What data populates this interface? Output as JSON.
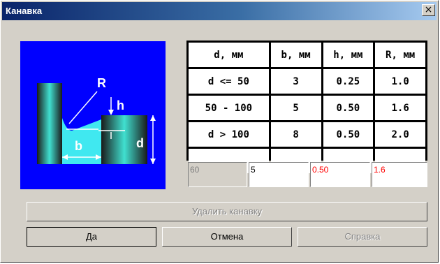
{
  "window": {
    "title": "Канавка",
    "close_label": "×"
  },
  "diagram": {
    "label_R": "R",
    "label_h": "h",
    "label_b": "b",
    "label_d": "d"
  },
  "table": {
    "headers": [
      "d, мм",
      "b, мм",
      "h, мм",
      "R, мм"
    ],
    "rows": [
      [
        "d <= 50",
        "3",
        "0.25",
        "1.0"
      ],
      [
        "50 - 100",
        "5",
        "0.50",
        "1.6"
      ],
      [
        "d > 100",
        "8",
        "0.50",
        "2.0"
      ],
      [
        "",
        "",
        "",
        ""
      ]
    ]
  },
  "inputs": {
    "d_value": "60",
    "b_value": "5",
    "h_value": "0.50",
    "r_value": "1.6"
  },
  "buttons": {
    "delete_label": "Удалить канавку",
    "ok_label": "Да",
    "cancel_label": "Отмена",
    "help_label": "Справка"
  },
  "colors": {
    "diagram_bg": "#0000ff",
    "invalid_text": "#ff0000"
  }
}
